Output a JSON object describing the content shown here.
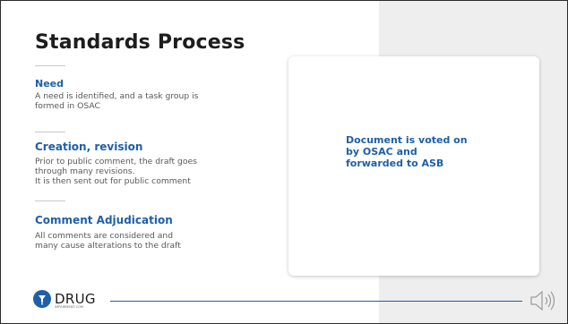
{
  "slide": {
    "title": "Standards Process",
    "sections": [
      {
        "heading": "Need",
        "text": [
          "A need is identified, and a task group is",
          "formed in OSAC"
        ]
      },
      {
        "heading": "Creation, revision",
        "text": [
          "Prior to public comment, the draft goes",
          "through many revisions.",
          "It is then sent out for public comment"
        ]
      },
      {
        "heading": "Comment Adjudication",
        "text": [
          "All comments are considered and",
          "many cause alterations to the draft"
        ]
      }
    ],
    "card_text": [
      "Document is voted on",
      "by OSAC and",
      "forwarded to ASB"
    ]
  },
  "footer": {
    "logo_word": "DRUG",
    "logo_sub": "IMPAIRMENT.COM",
    "audio_icon": "speaker-icon"
  },
  "colors": {
    "accent_blue": "#1f5fa8",
    "panel_gray": "#eeeeee"
  }
}
